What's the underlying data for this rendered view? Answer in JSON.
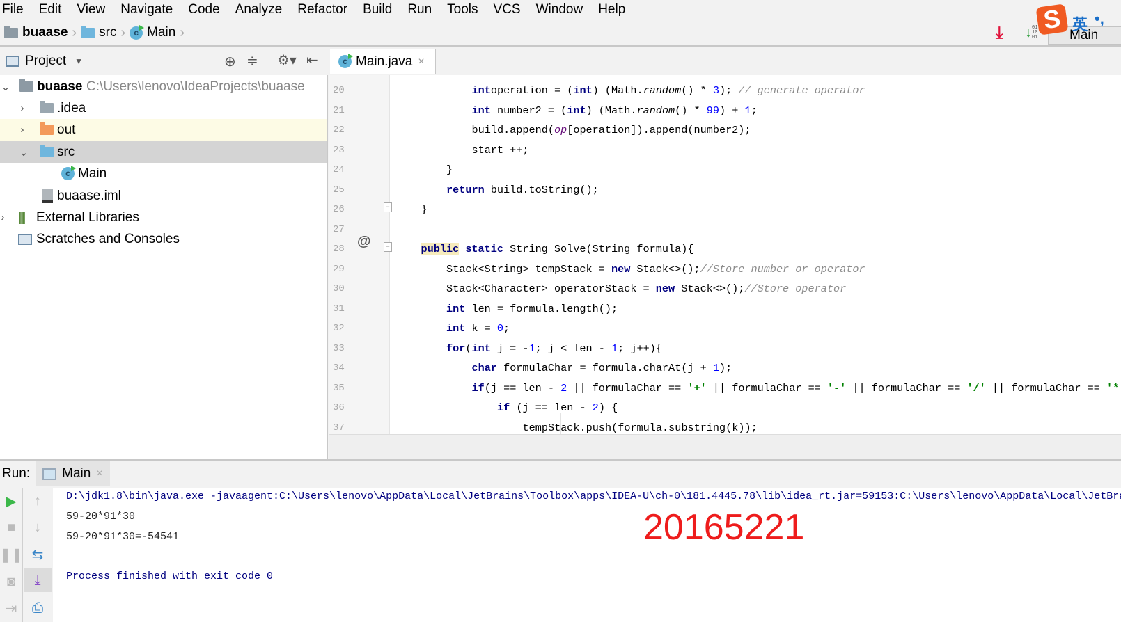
{
  "menubar": [
    "File",
    "Edit",
    "View",
    "Navigate",
    "Code",
    "Analyze",
    "Refactor",
    "Build",
    "Run",
    "Tools",
    "VCS",
    "Window",
    "Help"
  ],
  "breadcrumb": [
    "buaase",
    "src",
    "Main"
  ],
  "toolbar": {
    "run_config": "Main",
    "ime_mode": "英",
    "ime_punct": "•,"
  },
  "project": {
    "title": "Project",
    "tree": [
      {
        "label": "buaase",
        "path": "C:\\Users\\lenovo\\IdeaProjects\\buaase",
        "icon": "module-folder-icon",
        "expanded": true
      },
      {
        "label": ".idea",
        "icon": "folder-icon",
        "expanded": false
      },
      {
        "label": "out",
        "icon": "excluded-folder-icon",
        "expanded": false
      },
      {
        "label": "src",
        "icon": "source-folder-icon",
        "expanded": true,
        "selected": true
      },
      {
        "label": "Main",
        "icon": "class-icon"
      },
      {
        "label": "buaase.iml",
        "icon": "iml-file-icon"
      },
      {
        "label": "External Libraries",
        "icon": "libraries-icon",
        "expanded": false
      },
      {
        "label": "Scratches and Consoles",
        "icon": "scratches-icon"
      }
    ]
  },
  "editor": {
    "tab": "Main.java",
    "lines": [
      {
        "n": "20",
        "ind": 3,
        "tk": [
          [
            "kw",
            "int"
          ],
          [
            "",
            "operation = ("
          ],
          [
            "kw",
            "int"
          ],
          [
            "",
            ") (Math."
          ],
          [
            "it",
            "random"
          ],
          [
            "",
            "() * "
          ],
          [
            "num",
            "3"
          ],
          [
            "",
            "); "
          ],
          [
            "cm",
            "// generate operator"
          ]
        ]
      },
      {
        "n": "21",
        "ind": 3,
        "tk": [
          [
            "kw",
            "int"
          ],
          [
            "",
            " number2 = ("
          ],
          [
            "kw",
            "int"
          ],
          [
            "",
            ") (Math."
          ],
          [
            "it",
            "random"
          ],
          [
            "",
            "() * "
          ],
          [
            "num",
            "99"
          ],
          [
            "",
            ") + "
          ],
          [
            "num",
            "1"
          ],
          [
            "",
            ";"
          ]
        ]
      },
      {
        "n": "22",
        "ind": 3,
        "tk": [
          [
            "",
            "build.append("
          ],
          [
            "itp",
            "op"
          ],
          [
            "",
            "[operation]).append(number2);"
          ]
        ]
      },
      {
        "n": "23",
        "ind": 3,
        "tk": [
          [
            "",
            "start ++;"
          ]
        ]
      },
      {
        "n": "24",
        "ind": 2,
        "tk": [
          [
            "",
            "}"
          ]
        ]
      },
      {
        "n": "25",
        "ind": 2,
        "tk": [
          [
            "kw",
            "return"
          ],
          [
            "",
            " build.toString();"
          ]
        ]
      },
      {
        "n": "26",
        "ind": 1,
        "tk": [
          [
            "",
            "}"
          ]
        ]
      },
      {
        "n": "27",
        "ind": 1,
        "tk": []
      },
      {
        "n": "28",
        "ind": 1,
        "tk": [
          [
            "kw hl",
            "public"
          ],
          [
            "",
            " "
          ],
          [
            "kw",
            "static"
          ],
          [
            "",
            " String Solve(String formula){"
          ]
        ]
      },
      {
        "n": "29",
        "ind": 2,
        "tk": [
          [
            "",
            "Stack<String> tempStack = "
          ],
          [
            "kw",
            "new"
          ],
          [
            "",
            " Stack<>();"
          ],
          [
            "cm",
            "//Store number or operator"
          ]
        ]
      },
      {
        "n": "30",
        "ind": 2,
        "tk": [
          [
            "",
            "Stack<Character> operatorStack = "
          ],
          [
            "kw",
            "new"
          ],
          [
            "",
            " Stack<>();"
          ],
          [
            "cm",
            "//Store operator"
          ]
        ]
      },
      {
        "n": "31",
        "ind": 2,
        "tk": [
          [
            "kw",
            "int"
          ],
          [
            "",
            " len = formula.length();"
          ]
        ]
      },
      {
        "n": "32",
        "ind": 2,
        "tk": [
          [
            "kw",
            "int"
          ],
          [
            "",
            " k = "
          ],
          [
            "num",
            "0"
          ],
          [
            "",
            ";"
          ]
        ]
      },
      {
        "n": "33",
        "ind": 2,
        "tk": [
          [
            "kw",
            "for"
          ],
          [
            "",
            "("
          ],
          [
            "kw",
            "int"
          ],
          [
            "",
            " j = -"
          ],
          [
            "num",
            "1"
          ],
          [
            "",
            "; j < len - "
          ],
          [
            "num",
            "1"
          ],
          [
            "",
            "; j++){"
          ]
        ]
      },
      {
        "n": "34",
        "ind": 3,
        "tk": [
          [
            "kw",
            "char"
          ],
          [
            "",
            " formulaChar = formula.charAt(j + "
          ],
          [
            "num",
            "1"
          ],
          [
            "",
            ");"
          ]
        ]
      },
      {
        "n": "35",
        "ind": 3,
        "tk": [
          [
            "kw",
            "if"
          ],
          [
            "",
            "(j == len - "
          ],
          [
            "num",
            "2"
          ],
          [
            "",
            " || formulaChar == "
          ],
          [
            "str",
            "'+'"
          ],
          [
            "",
            " || formulaChar == "
          ],
          [
            "str",
            "'-'"
          ],
          [
            "",
            " || formulaChar == "
          ],
          [
            "str",
            "'/'"
          ],
          [
            "",
            " || formulaChar == "
          ],
          [
            "str",
            "'*'"
          ]
        ]
      },
      {
        "n": "36",
        "ind": 4,
        "tk": [
          [
            "kw",
            "if"
          ],
          [
            "",
            " (j == len - "
          ],
          [
            "num",
            "2"
          ],
          [
            "",
            ") {"
          ]
        ]
      },
      {
        "n": "37",
        "ind": 5,
        "tk": [
          [
            "",
            "tempStack.push(formula.substring(k));"
          ]
        ]
      }
    ]
  },
  "run": {
    "label": "Run:",
    "tab": "Main",
    "output": [
      "D:\\jdk1.8\\bin\\java.exe -javaagent:C:\\Users\\lenovo\\AppData\\Local\\JetBrains\\Toolbox\\apps\\IDEA-U\\ch-0\\181.4445.78\\lib\\idea_rt.jar=59153:C:\\Users\\lenovo\\AppData\\Local\\JetBra",
      "59-20*91*30",
      "59-20*91*30=-54541",
      "",
      "Process finished with exit code 0"
    ]
  },
  "annotation": "20165221",
  "colors": {
    "keyword": "#000080",
    "number": "#0000ff",
    "comment": "#8c8c8c",
    "string": "#008000",
    "annotation": "#ee1c1c",
    "run_green": "#3cb84a"
  }
}
